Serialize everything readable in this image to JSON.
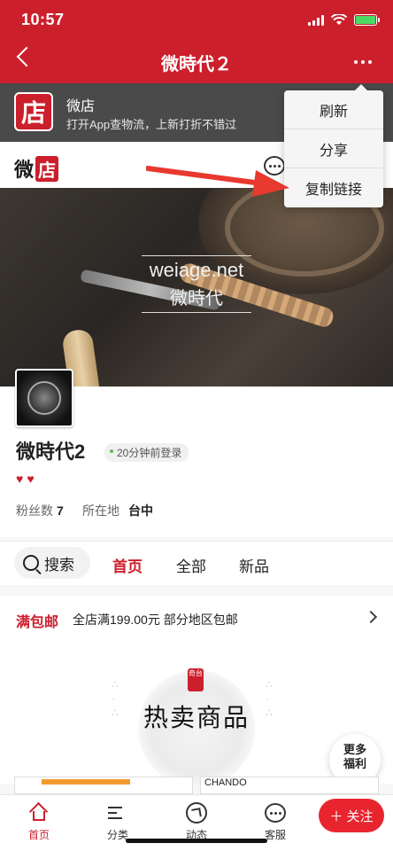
{
  "status_bar": {
    "time": "10:57"
  },
  "nav": {
    "title": "微時代２"
  },
  "app_banner": {
    "logo_char": "店",
    "name": "微店",
    "description": "打开App查物流，上新打折不错过"
  },
  "weidian_header": {
    "logo_text_left": "微",
    "logo_text_box": "店"
  },
  "hero": {
    "watermark_line1": "weiage.net",
    "watermark_line2": "微時代"
  },
  "profile": {
    "shop_name": "微時代2",
    "login_status": "20分钟前登录",
    "hearts": "♥♥",
    "fans_label": "粉丝数",
    "fans_count": "7",
    "location_label": "所在地",
    "location_value": "台中"
  },
  "tabs": {
    "search_label": "搜索",
    "items": [
      {
        "label": "首页",
        "active": true
      },
      {
        "label": "全部",
        "active": false
      },
      {
        "label": "新品",
        "active": false
      }
    ]
  },
  "promo": {
    "label": "满包邮",
    "text": "全店满199.00元 部分地区包邮"
  },
  "hot_section": {
    "title": "热卖商品",
    "seal_text": "奇台",
    "more_benefits_line1": "更多",
    "more_benefits_line2": "福利",
    "card2_text": "CHANDO"
  },
  "dropdown_menu": {
    "items": [
      {
        "label": "刷新"
      },
      {
        "label": "分享"
      },
      {
        "label": "复制链接"
      }
    ]
  },
  "bottom_bar": {
    "items": [
      {
        "label": "首页",
        "icon": "home-icon",
        "active": true
      },
      {
        "label": "分类",
        "icon": "category-icon",
        "active": false
      },
      {
        "label": "动态",
        "icon": "compass-icon",
        "active": false
      },
      {
        "label": "客服",
        "icon": "service-icon",
        "active": false
      }
    ],
    "follow_label": "关注"
  },
  "colors": {
    "brand_red": "#cc1f2c",
    "banner_gray": "#4a4a4a",
    "annotation_arrow": "#e8392e"
  }
}
